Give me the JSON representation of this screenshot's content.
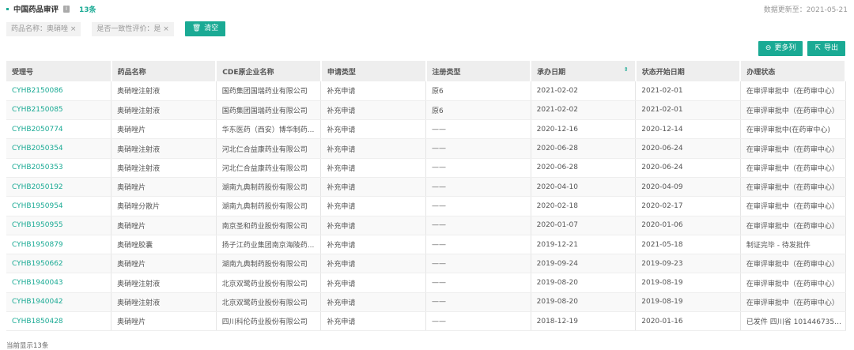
{
  "header": {
    "title": "中国药品审评",
    "count": "13条",
    "updated": "数据更新至：2021-05-21"
  },
  "filters": [
    {
      "label": "药品名称：奥硝唑 ×"
    },
    {
      "label": "是否一致性评价：是 ×"
    }
  ],
  "clear_label": "清空",
  "actions": {
    "more_columns": "更多列",
    "export": "导出"
  },
  "columns": [
    "受理号",
    "药品名称",
    "CDE原企业名称",
    "申请类型",
    "注册类型",
    "承办日期",
    "状态开始日期",
    "办理状态"
  ],
  "rows": [
    [
      "CYHB2150086",
      "奥硝唑注射液",
      "国药集团国瑞药业有限公司",
      "补充申请",
      "原6",
      "2021-02-02",
      "2021-02-01",
      "在审评审批中（在药审中心）"
    ],
    [
      "CYHB2150085",
      "奥硝唑注射液",
      "国药集团国瑞药业有限公司",
      "补充申请",
      "原6",
      "2021-02-02",
      "2021-02-01",
      "在审评审批中（在药审中心）"
    ],
    [
      "CYHB2050774",
      "奥硝唑片",
      "华东医药（西安）博华制药...",
      "补充申请",
      "——",
      "2020-12-16",
      "2020-12-14",
      "在审评审批中(在药审中心)"
    ],
    [
      "CYHB2050354",
      "奥硝唑注射液",
      "河北仁合益康药业有限公司",
      "补充申请",
      "——",
      "2020-06-28",
      "2020-06-24",
      "在审评审批中（在药审中心）"
    ],
    [
      "CYHB2050353",
      "奥硝唑注射液",
      "河北仁合益康药业有限公司",
      "补充申请",
      "——",
      "2020-06-28",
      "2020-06-24",
      "在审评审批中（在药审中心）"
    ],
    [
      "CYHB2050192",
      "奥硝唑片",
      "湖南九典制药股份有限公司",
      "补充申请",
      "——",
      "2020-04-10",
      "2020-04-09",
      "在审评审批中（在药审中心）"
    ],
    [
      "CYHB1950954",
      "奥硝唑分散片",
      "湖南九典制药股份有限公司",
      "补充申请",
      "——",
      "2020-02-18",
      "2020-02-17",
      "在审评审批中（在药审中心）"
    ],
    [
      "CYHB1950955",
      "奥硝唑片",
      "南京圣和药业股份有限公司",
      "补充申请",
      "——",
      "2020-01-07",
      "2020-01-06",
      "在审评审批中（在药审中心）"
    ],
    [
      "CYHB1950879",
      "奥硝唑胶囊",
      "扬子江药业集团南京海陵药...",
      "补充申请",
      "——",
      "2019-12-21",
      "2021-05-18",
      "制证完毕 - 待发批件"
    ],
    [
      "CYHB1950662",
      "奥硝唑片",
      "湖南九典制药股份有限公司",
      "补充申请",
      "——",
      "2019-09-24",
      "2019-09-23",
      "在审评审批中（在药审中心）"
    ],
    [
      "CYHB1940043",
      "奥硝唑注射液",
      "北京双鹭药业股份有限公司",
      "补充申请",
      "——",
      "2019-08-20",
      "2019-08-19",
      "在审评审批中（在药审中心）"
    ],
    [
      "CYHB1940042",
      "奥硝唑注射液",
      "北京双鹭药业股份有限公司",
      "补充申请",
      "——",
      "2019-08-20",
      "2019-08-19",
      "在审评审批中（在药审中心）"
    ],
    [
      "CYHB1850428",
      "奥硝唑片",
      "四川科伦药业股份有限公司",
      "补充申请",
      "——",
      "2018-12-19",
      "2020-01-16",
      "已发件 四川省 1014467357..."
    ]
  ],
  "footer": "当前显示13条"
}
